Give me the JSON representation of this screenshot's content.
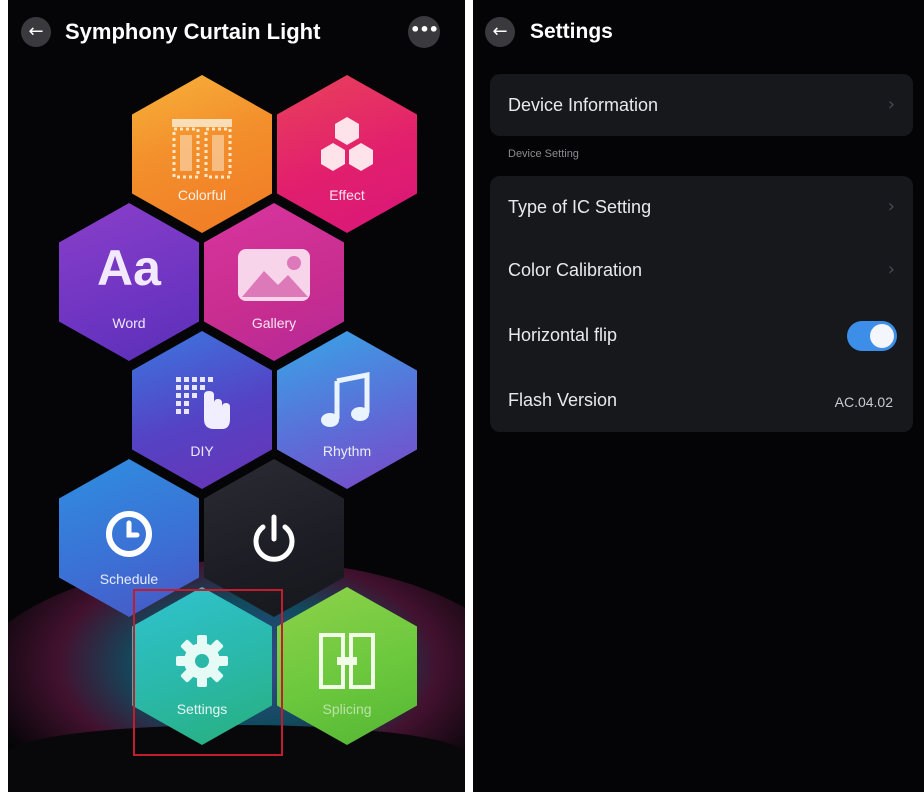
{
  "left_screen": {
    "title": "Symphony Curtain Light",
    "back_icon": "←",
    "more_icon": "•••",
    "tiles": [
      {
        "label": "Colorful",
        "icon": "curtain-icon"
      },
      {
        "label": "Effect",
        "icon": "hexagon-cluster-icon"
      },
      {
        "label": "Word",
        "icon_text": "Aa"
      },
      {
        "label": "Gallery",
        "icon": "image-icon"
      },
      {
        "label": "DIY",
        "icon": "pixel-hand-icon"
      },
      {
        "label": "Rhythm",
        "icon": "music-note-icon"
      },
      {
        "label": "Schedule",
        "icon": "clock-icon"
      },
      {
        "label": "",
        "icon": "power-icon"
      },
      {
        "label": "Settings",
        "icon": "gear-icon"
      },
      {
        "label": "Splicing",
        "icon": "splice-icon"
      }
    ]
  },
  "right_screen": {
    "title": "Settings",
    "back_icon": "←",
    "device_information": "Device Information",
    "section_header": "Device Setting",
    "rows": {
      "ic_setting": "Type of IC Setting",
      "color_calibration": "Color Calibration",
      "horizontal_flip": "Horizontal flip",
      "flash_version": "Flash Version"
    },
    "horizontal_flip_on": true,
    "flash_version_value": "AC.04.02",
    "chevron": "›"
  },
  "colors": {
    "toggle_on": "#3d8ee8",
    "selection_outline": "#c21d2e",
    "card_bg": "#17181c"
  }
}
